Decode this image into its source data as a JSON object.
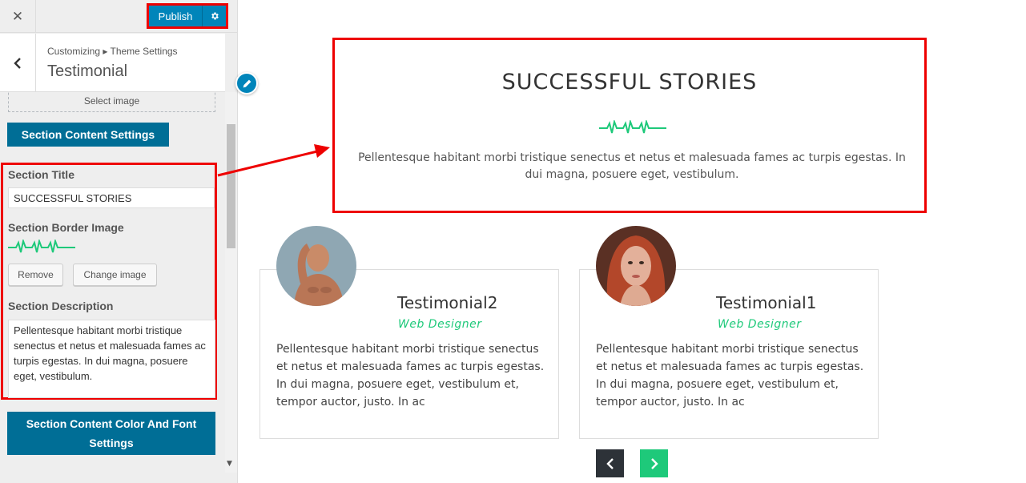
{
  "topbar": {
    "close_glyph": "✕",
    "publish_label": "Publish"
  },
  "panel": {
    "breadcrumb": "Customizing ▸ Theme Settings",
    "title": "Testimonial"
  },
  "controls": {
    "select_image_label": "Select image",
    "content_settings_heading": "Section Content Settings",
    "section_title_label": "Section Title",
    "section_title_value": "SUCCESSFUL STORIES",
    "border_image_label": "Section Border Image",
    "remove_label": "Remove",
    "change_image_label": "Change image",
    "description_label": "Section Description",
    "description_value": "Pellentesque habitant morbi tristique senectus et netus et malesuada fames ac turpis egestas. In dui magna, posuere eget, vestibulum.",
    "color_font_heading": "Section Content Color And Font Settings"
  },
  "preview": {
    "title": "SUCCESSFUL STORIES",
    "description": "Pellentesque habitant morbi tristique senectus et netus et malesuada fames ac turpis egestas. In dui magna, posuere eget, vestibulum.",
    "testimonials": [
      {
        "name": "Testimonial2",
        "role": "Web Designer",
        "text": "Pellentesque habitant morbi tristique senectus et netus et malesuada fames ac turpis egestas. In dui magna, posuere eget, vestibulum et, tempor auctor, justo. In ac"
      },
      {
        "name": "Testimonial1",
        "role": "Web Designer",
        "text": "Pellentesque habitant morbi tristique senectus et netus et malesuada fames ac turpis egestas. In dui magna, posuere eget, vestibulum et, tempor auctor, justo. In ac"
      }
    ]
  },
  "colors": {
    "wp_blue": "#0085ba",
    "heading_blue": "#006e96",
    "highlight_red": "#e00000",
    "accent_green": "#1ec97a",
    "dark_nav": "#2d3238"
  },
  "icons": [
    "close-icon",
    "gear-icon",
    "chevron-left-icon",
    "pencil-icon",
    "heartbeat-wave-icon",
    "chevron-right-icon",
    "arrow-icon"
  ]
}
